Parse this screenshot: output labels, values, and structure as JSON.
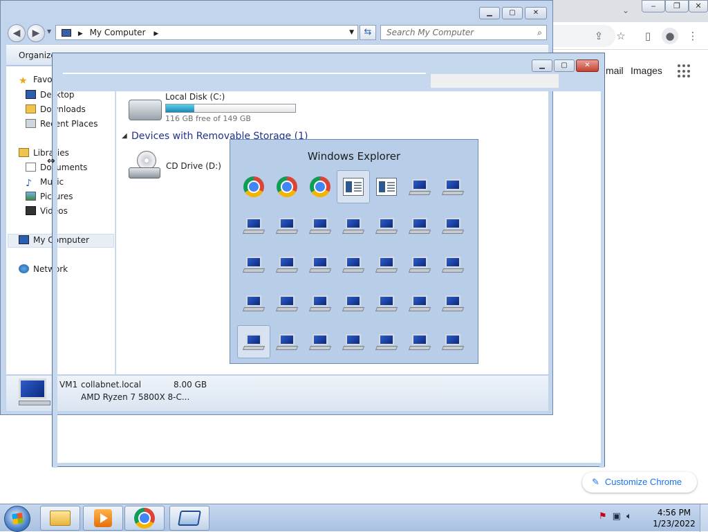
{
  "chrome": {
    "links": {
      "gmail": "mail",
      "images": "Images"
    },
    "customize_label": "Customize Chrome",
    "icons": [
      "share-icon",
      "star-icon",
      "sidebar-icon",
      "profile-icon",
      "menu-icon",
      "apps-icon"
    ]
  },
  "explorer": {
    "address": "My Computer",
    "search_placeholder": "Search My Computer",
    "organize": "Organize",
    "nav": {
      "favorites": "Favorites",
      "desktop": "Desktop",
      "downloads": "Downloads",
      "recent": "Recent Places",
      "libraries": "Libraries",
      "documents": "Documents",
      "music": "Music",
      "pictures": "Pictures",
      "videos": "Videos",
      "computer": "My Computer",
      "network": "Network"
    },
    "drives": {
      "local_name": "Local Disk (C:)",
      "local_free": "116 GB free of 149 GB",
      "local_used_fraction": 0.22,
      "removable_header": "Devices with Removable Storage (1)",
      "cd_name": "CD Drive (D:)"
    },
    "details": {
      "name": "VM1",
      "domain": "collabnet.local",
      "memory": "8.00 GB",
      "cpu": "AMD Ryzen 7 5800X 8-C..."
    }
  },
  "switcher": {
    "title": "Windows Explorer",
    "icons": [
      "chrome-icon",
      "chrome-icon",
      "chrome-icon",
      "document-icon",
      "document-icon",
      "computer-icon",
      "computer-icon",
      "computer-icon",
      "computer-icon",
      "computer-icon",
      "computer-icon",
      "computer-icon",
      "computer-icon",
      "computer-icon",
      "computer-icon",
      "computer-icon",
      "computer-icon",
      "computer-icon",
      "computer-icon",
      "computer-icon",
      "computer-icon",
      "computer-icon",
      "computer-icon",
      "computer-icon",
      "computer-icon",
      "computer-icon",
      "computer-icon",
      "computer-icon",
      "computer-icon",
      "computer-icon",
      "computer-icon",
      "computer-icon",
      "computer-icon",
      "computer-icon",
      "computer-icon"
    ],
    "selected": [
      3,
      28
    ]
  },
  "taskbar": {
    "time": "4:56 PM",
    "date": "1/23/2022"
  }
}
